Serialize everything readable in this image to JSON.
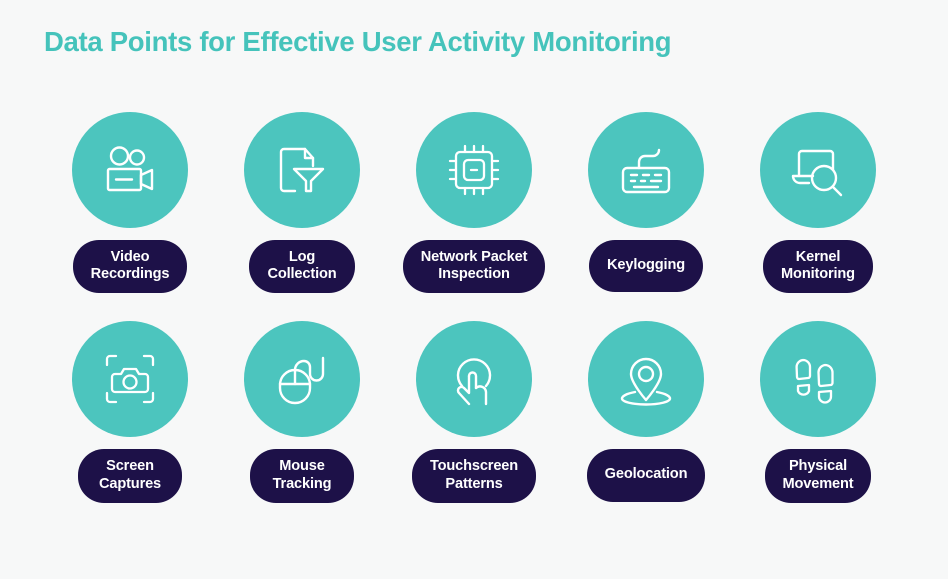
{
  "header": {
    "title": "Data Points for Effective User Activity Monitoring"
  },
  "theme": {
    "background": "#f7f8f8",
    "accent_teal": "#4cc5be",
    "title_color": "#45c3bb",
    "pill_background": "#1d1148",
    "pill_text": "#ffffff",
    "icon_stroke": "#ffffff"
  },
  "items": [
    {
      "id": "video-recordings",
      "icon": "video-camera-icon",
      "line1": "Video",
      "line2": "Recordings",
      "row": 1,
      "column": 1
    },
    {
      "id": "log-collection",
      "icon": "document-funnel-icon",
      "line1": "Log",
      "line2": "Collection",
      "row": 1,
      "column": 2
    },
    {
      "id": "network-packet-inspection",
      "icon": "cpu-chip-icon",
      "line1": "Network Packet",
      "line2": "Inspection",
      "row": 1,
      "column": 3
    },
    {
      "id": "keylogging",
      "icon": "keyboard-icon",
      "line1": "Keylogging",
      "line2": "",
      "row": 1,
      "column": 4
    },
    {
      "id": "kernel-monitoring",
      "icon": "laptop-search-icon",
      "line1": "Kernel",
      "line2": "Monitoring",
      "row": 1,
      "column": 5
    },
    {
      "id": "screen-captures",
      "icon": "camera-frame-icon",
      "line1": "Screen",
      "line2": "Captures",
      "row": 2,
      "column": 1
    },
    {
      "id": "mouse-tracking",
      "icon": "computer-mouse-icon",
      "line1": "Mouse",
      "line2": "Tracking",
      "row": 2,
      "column": 2
    },
    {
      "id": "touchscreen-patterns",
      "icon": "tap-gesture-icon",
      "line1": "Touchscreen",
      "line2": "Patterns",
      "row": 2,
      "column": 3
    },
    {
      "id": "geolocation",
      "icon": "map-pin-icon",
      "line1": "Geolocation",
      "line2": "",
      "row": 2,
      "column": 4
    },
    {
      "id": "physical-movement",
      "icon": "footprints-icon",
      "line1": "Physical",
      "line2": "Movement",
      "row": 2,
      "column": 5
    }
  ]
}
